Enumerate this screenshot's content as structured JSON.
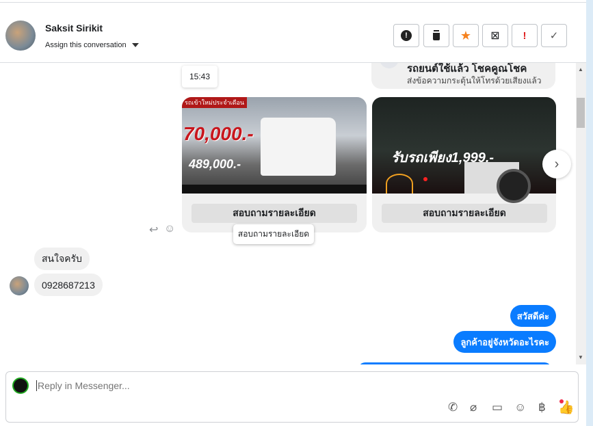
{
  "header": {
    "name": "Saksit Sirikit",
    "assign_label": "Assign this conversation",
    "actions": [
      {
        "icon": "spam-icon",
        "glyph": "⬢"
      },
      {
        "icon": "trash-icon",
        "glyph": "🗑"
      },
      {
        "icon": "star-icon",
        "glyph": "★",
        "color": "#f5821f"
      },
      {
        "icon": "archive-icon",
        "glyph": "⊠"
      },
      {
        "icon": "important-icon",
        "glyph": "!",
        "color": "#e02020"
      },
      {
        "icon": "done-icon",
        "glyph": "✓"
      }
    ]
  },
  "chat": {
    "top_card": {
      "title": "รถยนต์ใช้แล้ว โชคคูณโชค",
      "subtitle": "ส่งข้อความกระตุ้นให้โทรด้วยเสียงแล้ว"
    },
    "timestamp": "15:43",
    "cards": [
      {
        "image_text": [
          "รถเข้าใหม่ประจำเดือน",
          "70,000.-",
          "489,000.-"
        ],
        "button": "สอบถามรายละเอียด"
      },
      {
        "image_text": [
          "รับรถเพียง1,999.-"
        ],
        "button": "สอบถามรายละเอียด"
      }
    ],
    "tooltip": "สอบถามรายละเอียด",
    "incoming": [
      "สนใจครับ",
      "0928687213"
    ],
    "outgoing": [
      "สวัสดีค่ะ",
      "ลูกค้าอยู่จังหวัดอะไรคะ"
    ]
  },
  "composer": {
    "placeholder": "Reply in Messenger...",
    "tools": [
      "phone-icon",
      "attachment-icon",
      "saved-reply-icon",
      "emoji-icon",
      "baht-payment-icon",
      "like-icon"
    ],
    "colors": {
      "accent": "#0a7cff",
      "notify": "#f02849"
    }
  }
}
